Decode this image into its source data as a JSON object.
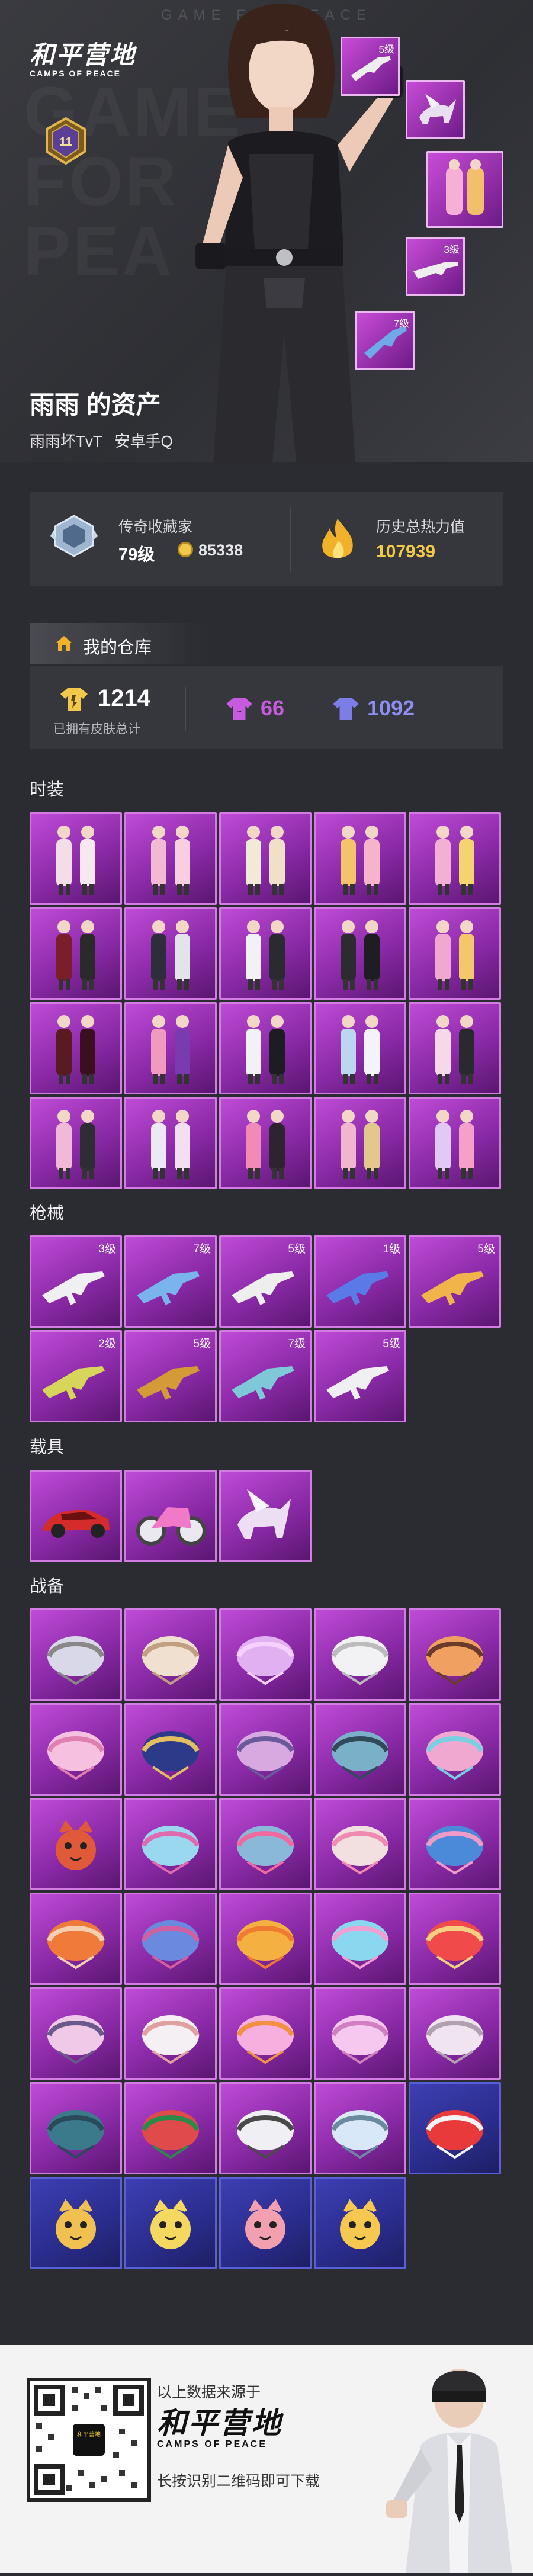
{
  "hero": {
    "top_banner": "GAME FOR PEACE",
    "logo_cn": "和平营地",
    "logo_en": "CAMPS OF PEACE",
    "bg_text": [
      "GAME",
      "FOR",
      "PEA"
    ],
    "rank_level": "11",
    "owner_name": "雨雨 的资产",
    "owner_nick": "雨雨坏TvT",
    "owner_server": "安卓手Q",
    "side_levels": [
      "5级",
      "",
      "",
      "3级",
      "7级"
    ]
  },
  "stats": {
    "collector_label": "传奇收藏家",
    "collector_level": "79级",
    "collector_points": "85338",
    "heat_label": "历史总热力值",
    "heat_value": "107939"
  },
  "warehouse": {
    "title": "我的仓库",
    "total_skins": "1214",
    "total_label": "已拥有皮肤总计",
    "purple_count": "66",
    "blue_count": "1092"
  },
  "sections": {
    "outfits": "时装",
    "guns": "枪械",
    "vehicles": "载具",
    "gear": "战备"
  },
  "guns_levels": [
    "3级",
    "7级",
    "5级",
    "1级",
    "5级",
    "2级",
    "5级",
    "7级",
    "5级"
  ],
  "footer": {
    "source_text": "以上数据来源于",
    "logo_cn": "和平营地",
    "logo_en": "CAMPS OF PEACE",
    "download_text": "长按识别二维码即可下载",
    "qr_center_text": "和平营地"
  },
  "colors": {
    "background": "#2b2c31",
    "panel": "#36373d",
    "gold": "#f1c84a",
    "purple_item": "#a43cc2",
    "blue_item": "#2f3199",
    "purple_count": "#c65be0",
    "blue_count": "#7c7de6"
  }
}
